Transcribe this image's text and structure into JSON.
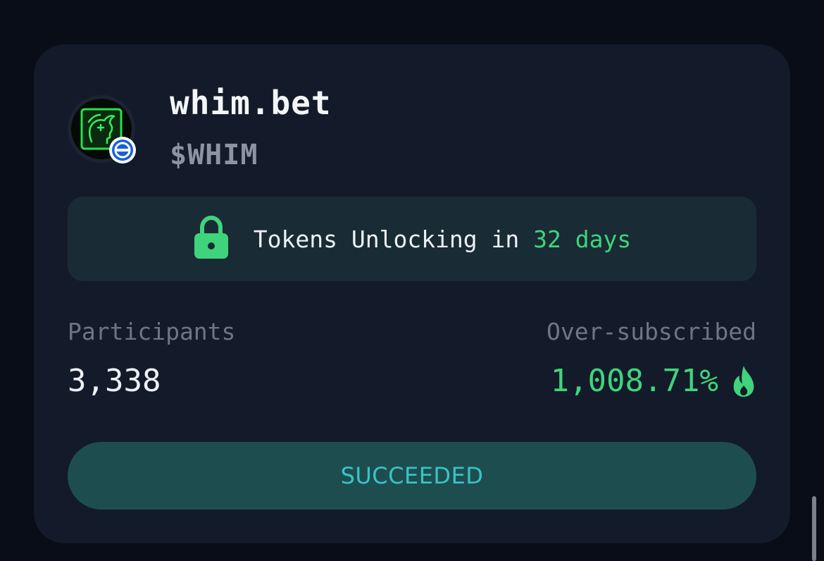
{
  "project": {
    "name": "whim.bet",
    "symbol": "$WHIM",
    "avatar_icon": "jester-head-icon",
    "chain_icon": "chain-badge-icon"
  },
  "unlock": {
    "prefix": "Tokens Unlocking in ",
    "days": "32 days",
    "icon": "lock-icon"
  },
  "stats": {
    "participants_label": "Participants",
    "participants_value": "3,338",
    "oversubscribed_label": "Over-subscribed",
    "oversubscribed_value": "1,008.71%",
    "oversubscribed_icon": "fire-icon"
  },
  "status": {
    "label": "SUCCEEDED"
  },
  "colors": {
    "background": "#080d18",
    "card": "#131a29",
    "accent_green": "#3fd47c",
    "status_bg": "#1e4d50",
    "status_text": "#39c4c4"
  }
}
